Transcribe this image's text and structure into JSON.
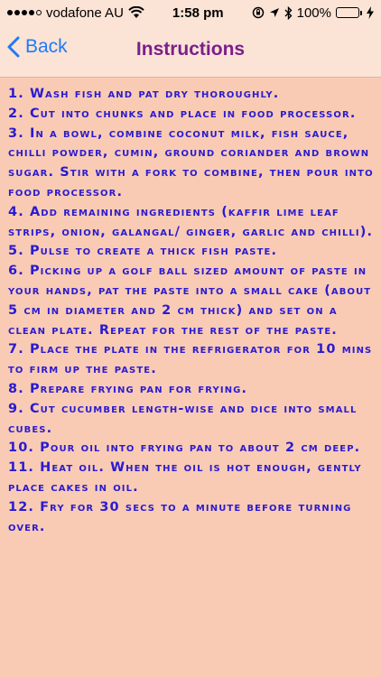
{
  "status_bar": {
    "carrier": "vodafone AU",
    "time": "1:58 pm",
    "battery": "100%",
    "icons": [
      "signal-dots",
      "wifi-icon",
      "rotation-lock-icon",
      "location-icon",
      "bluetooth-icon",
      "battery-icon",
      "charging-icon"
    ]
  },
  "nav": {
    "back_label": "Back",
    "title": "Instructions"
  },
  "colors": {
    "background": "#f9cbb5",
    "bar": "#fbe3d6",
    "text": "#2b1bcf",
    "title": "#7a1f8c",
    "accent": "#1f7bf6"
  },
  "instructions": [
    "1. Wash fish and pat dry thoroughly.",
    "2. Cut into chunks and place in food processor.",
    "3. In a bowl, combine coconut milk, fish sauce, chilli powder, cumin, ground coriander and brown sugar. Stir with a fork to combine, then pour into food processor.",
    "4. Add remaining ingredients (kaffir lime leaf strips, onion, galangal/ ginger, garlic and chilli).",
    "5. Pulse to create a thick fish paste.",
    "6. Picking up a golf ball sized amount of paste in your hands, pat the paste into a small cake  (about 5 cm in diameter and 2 cm thick) and set on a clean plate. Repeat for the rest of the paste.",
    "7. Place the plate in the refrigerator for 10 mins to firm up the paste.",
    "8. Prepare frying pan for frying.",
    "9. Cut cucumber length-wise and dice into small cubes.",
    "10. Pour oil into frying pan to about 2 cm deep.",
    "11. Heat oil. When the oil is hot enough, gently place cakes in oil.",
    "12. Fry for 30 secs to a minute before turning over."
  ]
}
